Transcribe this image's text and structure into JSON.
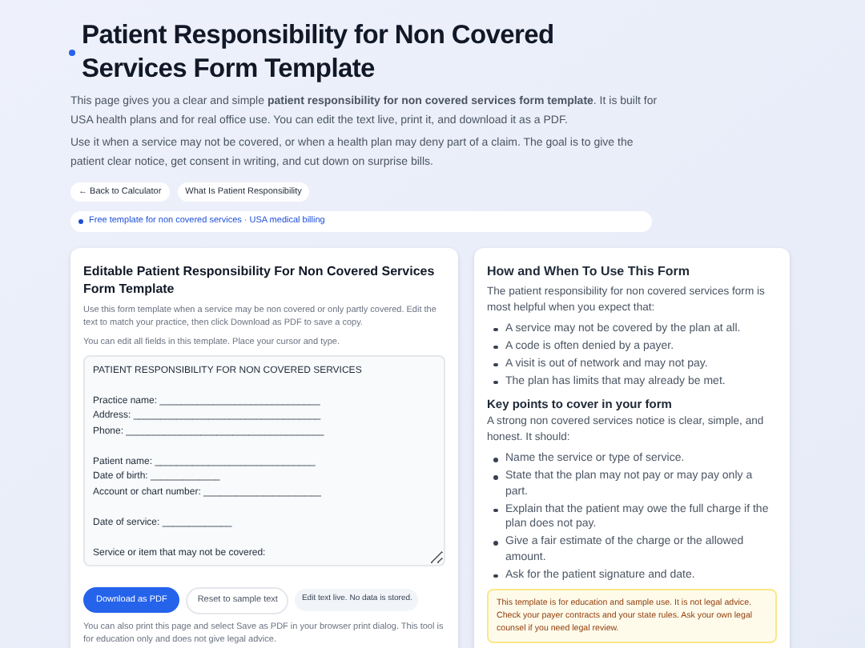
{
  "header": {
    "title": "Patient Responsibility for Non Covered Services Form Template",
    "intro": "This page gives you a clear and simple **patient responsibility for non covered services form template**. It is built for USA health plans and for real office use. You can edit the text live, print it, and download it as a PDF.",
    "intro_2": "Use it when a service may not be covered, or when a health plan may deny part of a claim. The goal is to give the patient clear notice, get consent in writing, and cut down on surprise bills.",
    "links": [
      "← Back to Calculator",
      "What Is Patient Responsibility"
    ],
    "tagline": "Free template for non covered services · USA medical billing"
  },
  "editor": {
    "title": "Editable Patient Responsibility For Non Covered Services Form Template",
    "description": "Use this form template when a service may be non covered or only partly covered. Edit the text to match your practice, then click Download as PDF to save a copy.",
    "hint": "You can edit all fields in this template. Place your cursor and type.",
    "form_text": "PATIENT RESPONSIBILITY FOR NON COVERED SERVICES\n\nPractice name: ______________________________\nAddress: ___________________________________\nPhone: _____________________________________\n\nPatient name: ______________________________\nDate of birth: _____________\nAccount or chart number: ______________________\n\nDate of service: _____________\n\nService or item that may not be covered:",
    "download_button": "Download as PDF",
    "reset_button": "Reset to sample text",
    "status_chip": "Edit text live. No data is stored.",
    "footnote": "You can also print this page and select Save as PDF in your browser print dialog. This tool is for education only and does not give legal advice."
  },
  "guide": {
    "title": "How and When To Use This Form",
    "intro": "The patient responsibility for non covered services form is most helpful when you expect that:",
    "bullets": [
      "A service may not be covered by the plan at all.",
      "A code is often denied by a payer.",
      "A visit is out of network and may not pay.",
      "The plan has limits that may already be met."
    ],
    "subtitle": "Key points to cover in your form",
    "intro_2": "A strong non covered services notice is clear, simple, and honest. It should:",
    "bullets_2": [
      "Name the service or type of service.",
      "State that the plan may not pay or may pay only a part.",
      "Explain that the patient may owe the full charge if the plan does not pay.",
      "Give a fair estimate of the charge or the allowed amount.",
      "Ask for the patient signature and date."
    ],
    "warning": "This template is for education and sample use. It is not legal advice. Check your payer contracts and your state rules. Ask your own legal counsel if you need legal review."
  }
}
